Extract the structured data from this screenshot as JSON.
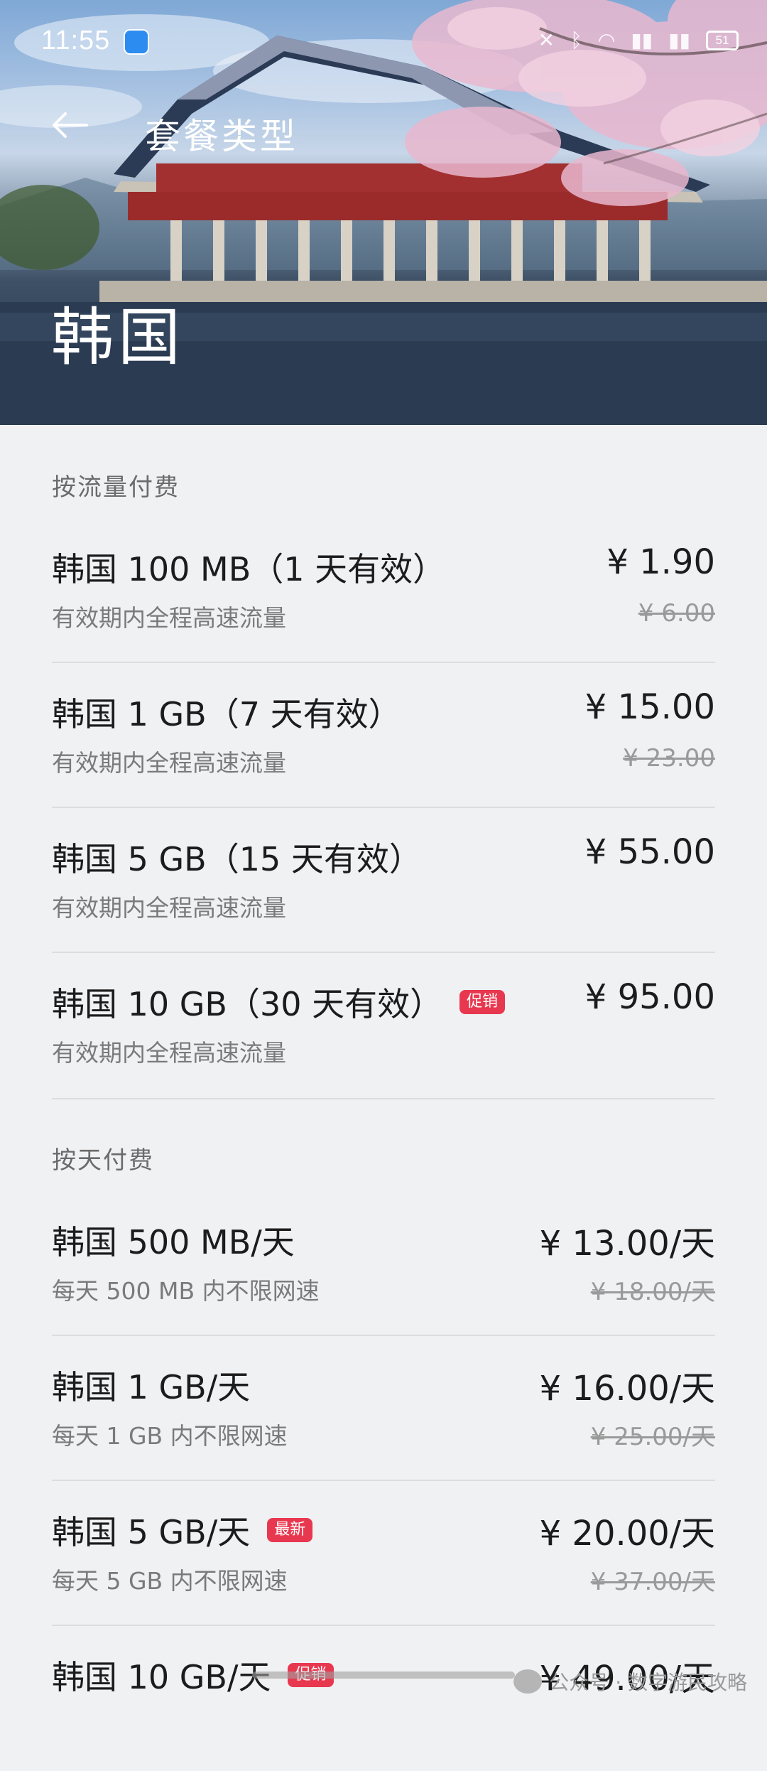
{
  "status_bar": {
    "time": "11:55",
    "battery": "51"
  },
  "nav": {
    "title": "套餐类型",
    "back_icon": "arrow-left-icon"
  },
  "hero": {
    "country": "韩国"
  },
  "sections": [
    {
      "title": "按流量付费",
      "items": [
        {
          "name": "韩国 100 MB（1 天有效）",
          "desc": "有效期内全程高速流量",
          "price": "¥ 1.90",
          "original_price": "¥ 6.00",
          "badge": ""
        },
        {
          "name": "韩国 1 GB（7 天有效）",
          "desc": "有效期内全程高速流量",
          "price": "¥ 15.00",
          "original_price": "¥ 23.00",
          "badge": ""
        },
        {
          "name": "韩国 5 GB（15 天有效）",
          "desc": "有效期内全程高速流量",
          "price": "¥ 55.00",
          "original_price": "",
          "badge": ""
        },
        {
          "name": "韩国 10 GB（30 天有效）",
          "desc": "有效期内全程高速流量",
          "price": "¥ 95.00",
          "original_price": "",
          "badge": "促销"
        }
      ]
    },
    {
      "title": "按天付费",
      "items": [
        {
          "name": "韩国 500 MB/天",
          "desc": "每天 500 MB 内不限网速",
          "price": "¥ 13.00/天",
          "original_price": "¥ 18.00/天",
          "badge": ""
        },
        {
          "name": "韩国 1 GB/天",
          "desc": "每天 1 GB 内不限网速",
          "price": "¥ 16.00/天",
          "original_price": "¥ 25.00/天",
          "badge": ""
        },
        {
          "name": "韩国 5 GB/天",
          "desc": "每天 5 GB 内不限网速",
          "price": "¥ 20.00/天",
          "original_price": "¥ 37.00/天",
          "badge": "最新"
        },
        {
          "name": "韩国 10 GB/天",
          "desc": "",
          "price": "¥ 49.00/天",
          "original_price": "",
          "badge": "促销"
        }
      ]
    }
  ],
  "watermark": {
    "text": "公众号 · 数字游民攻略"
  },
  "colors": {
    "background": "#f0f1f3",
    "badge": "#e8384f",
    "text_primary": "#1c1c1c",
    "text_secondary": "#7a7a7a"
  }
}
